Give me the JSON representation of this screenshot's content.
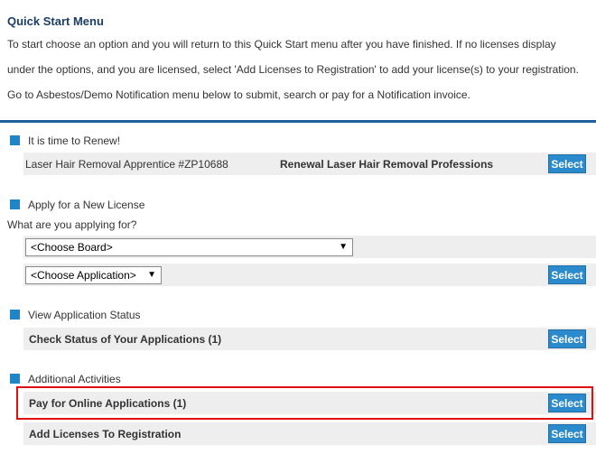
{
  "quick_start": {
    "title": "Quick Start Menu",
    "lines": [
      "To start choose an option and you will return to this Quick Start menu after you have finished. If no licenses display",
      "under the options, and you are licensed, select 'Add Licenses to Registration' to add your license(s) to your registration.",
      "Go to Asbestos/Demo Notification menu below to submit, search or pay for a Notification invoice."
    ]
  },
  "renew": {
    "heading": "It is time to Renew!",
    "license": "Laser Hair Removal Apprentice  #ZP10688",
    "renewal_label": "Renewal Laser Hair Removal Professions",
    "button": "Select"
  },
  "apply": {
    "heading": "Apply for a New License",
    "prompt": "What are you applying for?",
    "board_select": "<Choose Board>",
    "application_select": "<Choose Application>",
    "caret": "▼",
    "button": "Select"
  },
  "status": {
    "heading": "View Application Status",
    "item": "Check Status of Your Applications (1)",
    "button": "Select"
  },
  "additional": {
    "heading": "Additional Activities",
    "items": [
      {
        "label": "Pay for Online Applications (1)",
        "button": "Select"
      },
      {
        "label": "Add Licenses To Registration",
        "button": "Select"
      }
    ]
  }
}
